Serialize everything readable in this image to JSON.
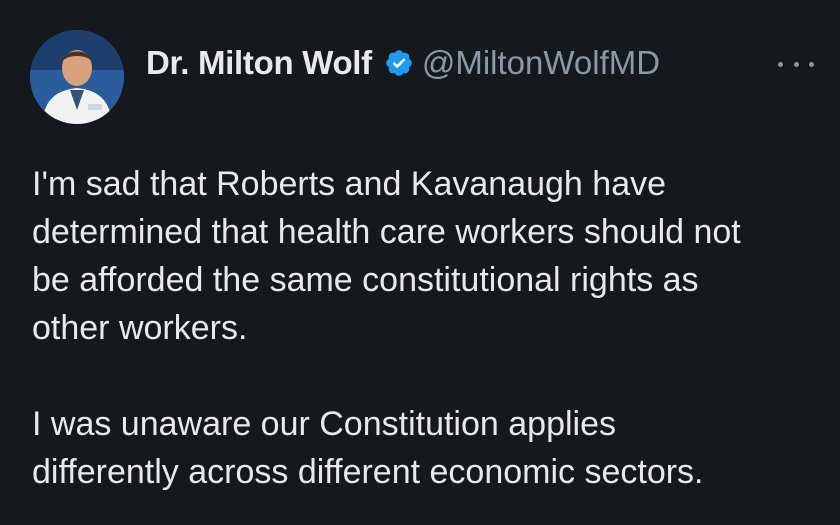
{
  "tweet": {
    "author": {
      "display_name": "Dr. Milton Wolf",
      "handle": "@MiltonWolfMD",
      "verified": true,
      "avatar_icon": "profile-photo-icon"
    },
    "more_icon": "more-options-icon",
    "body": {
      "lines_p1": [
        "I'm sad that Roberts and Kavanaugh have",
        "determined that health care workers should not",
        "be afforded the same constitutional rights as",
        "other workers."
      ],
      "lines_p2": [
        "I was unaware our Constitution applies",
        "differently across different economic sectors."
      ]
    }
  },
  "colors": {
    "background": "#15181c",
    "primary_text": "#e7e9ea",
    "secondary_text": "#8b98a5",
    "verified_badge": "#1d9bf0"
  }
}
